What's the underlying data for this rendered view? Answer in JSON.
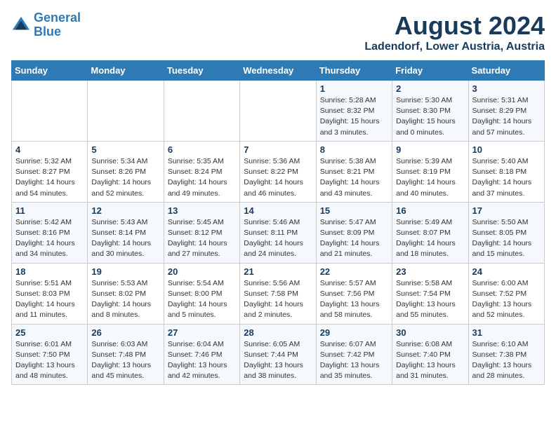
{
  "header": {
    "logo_line1": "General",
    "logo_line2": "Blue",
    "main_title": "August 2024",
    "subtitle": "Ladendorf, Lower Austria, Austria"
  },
  "days_of_week": [
    "Sunday",
    "Monday",
    "Tuesday",
    "Wednesday",
    "Thursday",
    "Friday",
    "Saturday"
  ],
  "weeks": [
    [
      {
        "day": "",
        "info": ""
      },
      {
        "day": "",
        "info": ""
      },
      {
        "day": "",
        "info": ""
      },
      {
        "day": "",
        "info": ""
      },
      {
        "day": "1",
        "info": "Sunrise: 5:28 AM\nSunset: 8:32 PM\nDaylight: 15 hours\nand 3 minutes."
      },
      {
        "day": "2",
        "info": "Sunrise: 5:30 AM\nSunset: 8:30 PM\nDaylight: 15 hours\nand 0 minutes."
      },
      {
        "day": "3",
        "info": "Sunrise: 5:31 AM\nSunset: 8:29 PM\nDaylight: 14 hours\nand 57 minutes."
      }
    ],
    [
      {
        "day": "4",
        "info": "Sunrise: 5:32 AM\nSunset: 8:27 PM\nDaylight: 14 hours\nand 54 minutes."
      },
      {
        "day": "5",
        "info": "Sunrise: 5:34 AM\nSunset: 8:26 PM\nDaylight: 14 hours\nand 52 minutes."
      },
      {
        "day": "6",
        "info": "Sunrise: 5:35 AM\nSunset: 8:24 PM\nDaylight: 14 hours\nand 49 minutes."
      },
      {
        "day": "7",
        "info": "Sunrise: 5:36 AM\nSunset: 8:22 PM\nDaylight: 14 hours\nand 46 minutes."
      },
      {
        "day": "8",
        "info": "Sunrise: 5:38 AM\nSunset: 8:21 PM\nDaylight: 14 hours\nand 43 minutes."
      },
      {
        "day": "9",
        "info": "Sunrise: 5:39 AM\nSunset: 8:19 PM\nDaylight: 14 hours\nand 40 minutes."
      },
      {
        "day": "10",
        "info": "Sunrise: 5:40 AM\nSunset: 8:18 PM\nDaylight: 14 hours\nand 37 minutes."
      }
    ],
    [
      {
        "day": "11",
        "info": "Sunrise: 5:42 AM\nSunset: 8:16 PM\nDaylight: 14 hours\nand 34 minutes."
      },
      {
        "day": "12",
        "info": "Sunrise: 5:43 AM\nSunset: 8:14 PM\nDaylight: 14 hours\nand 30 minutes."
      },
      {
        "day": "13",
        "info": "Sunrise: 5:45 AM\nSunset: 8:12 PM\nDaylight: 14 hours\nand 27 minutes."
      },
      {
        "day": "14",
        "info": "Sunrise: 5:46 AM\nSunset: 8:11 PM\nDaylight: 14 hours\nand 24 minutes."
      },
      {
        "day": "15",
        "info": "Sunrise: 5:47 AM\nSunset: 8:09 PM\nDaylight: 14 hours\nand 21 minutes."
      },
      {
        "day": "16",
        "info": "Sunrise: 5:49 AM\nSunset: 8:07 PM\nDaylight: 14 hours\nand 18 minutes."
      },
      {
        "day": "17",
        "info": "Sunrise: 5:50 AM\nSunset: 8:05 PM\nDaylight: 14 hours\nand 15 minutes."
      }
    ],
    [
      {
        "day": "18",
        "info": "Sunrise: 5:51 AM\nSunset: 8:03 PM\nDaylight: 14 hours\nand 11 minutes."
      },
      {
        "day": "19",
        "info": "Sunrise: 5:53 AM\nSunset: 8:02 PM\nDaylight: 14 hours\nand 8 minutes."
      },
      {
        "day": "20",
        "info": "Sunrise: 5:54 AM\nSunset: 8:00 PM\nDaylight: 14 hours\nand 5 minutes."
      },
      {
        "day": "21",
        "info": "Sunrise: 5:56 AM\nSunset: 7:58 PM\nDaylight: 14 hours\nand 2 minutes."
      },
      {
        "day": "22",
        "info": "Sunrise: 5:57 AM\nSunset: 7:56 PM\nDaylight: 13 hours\nand 58 minutes."
      },
      {
        "day": "23",
        "info": "Sunrise: 5:58 AM\nSunset: 7:54 PM\nDaylight: 13 hours\nand 55 minutes."
      },
      {
        "day": "24",
        "info": "Sunrise: 6:00 AM\nSunset: 7:52 PM\nDaylight: 13 hours\nand 52 minutes."
      }
    ],
    [
      {
        "day": "25",
        "info": "Sunrise: 6:01 AM\nSunset: 7:50 PM\nDaylight: 13 hours\nand 48 minutes."
      },
      {
        "day": "26",
        "info": "Sunrise: 6:03 AM\nSunset: 7:48 PM\nDaylight: 13 hours\nand 45 minutes."
      },
      {
        "day": "27",
        "info": "Sunrise: 6:04 AM\nSunset: 7:46 PM\nDaylight: 13 hours\nand 42 minutes."
      },
      {
        "day": "28",
        "info": "Sunrise: 6:05 AM\nSunset: 7:44 PM\nDaylight: 13 hours\nand 38 minutes."
      },
      {
        "day": "29",
        "info": "Sunrise: 6:07 AM\nSunset: 7:42 PM\nDaylight: 13 hours\nand 35 minutes."
      },
      {
        "day": "30",
        "info": "Sunrise: 6:08 AM\nSunset: 7:40 PM\nDaylight: 13 hours\nand 31 minutes."
      },
      {
        "day": "31",
        "info": "Sunrise: 6:10 AM\nSunset: 7:38 PM\nDaylight: 13 hours\nand 28 minutes."
      }
    ]
  ]
}
